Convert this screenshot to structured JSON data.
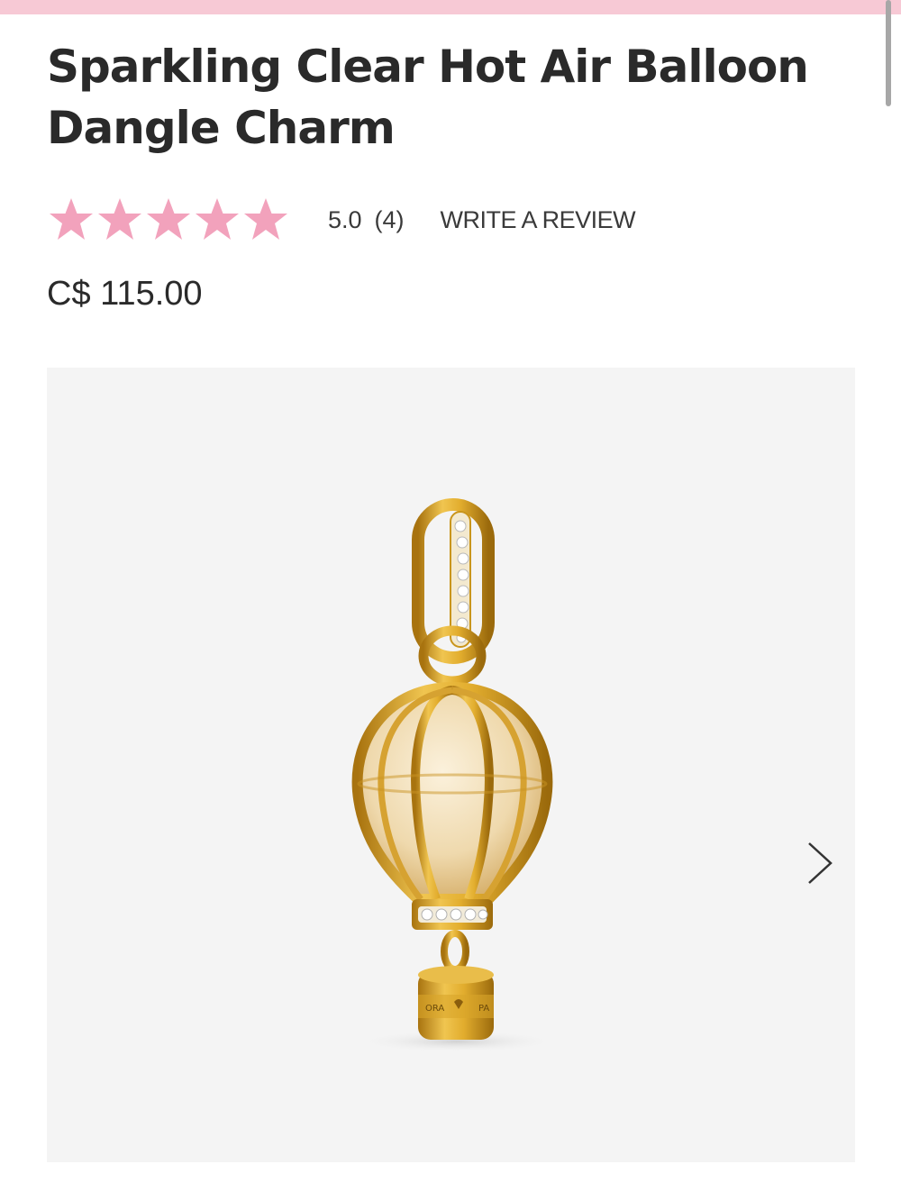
{
  "product": {
    "title": "Sparkling Clear Hot Air Balloon Dangle Charm",
    "rating": {
      "stars": 5,
      "value": "5.0",
      "count": "(4)",
      "write_review_label": "WRITE A REVIEW"
    },
    "price": "C$ 115.00"
  },
  "gallery": {
    "engraving_left": "ORA",
    "engraving_right": "PA",
    "next_icon": "chevron-right-icon"
  },
  "colors": {
    "accent_pink": "#f2a2bc",
    "top_bar": "#f7c9d5",
    "gold": "#d9a52a",
    "panel_bg": "#f4f4f4"
  }
}
